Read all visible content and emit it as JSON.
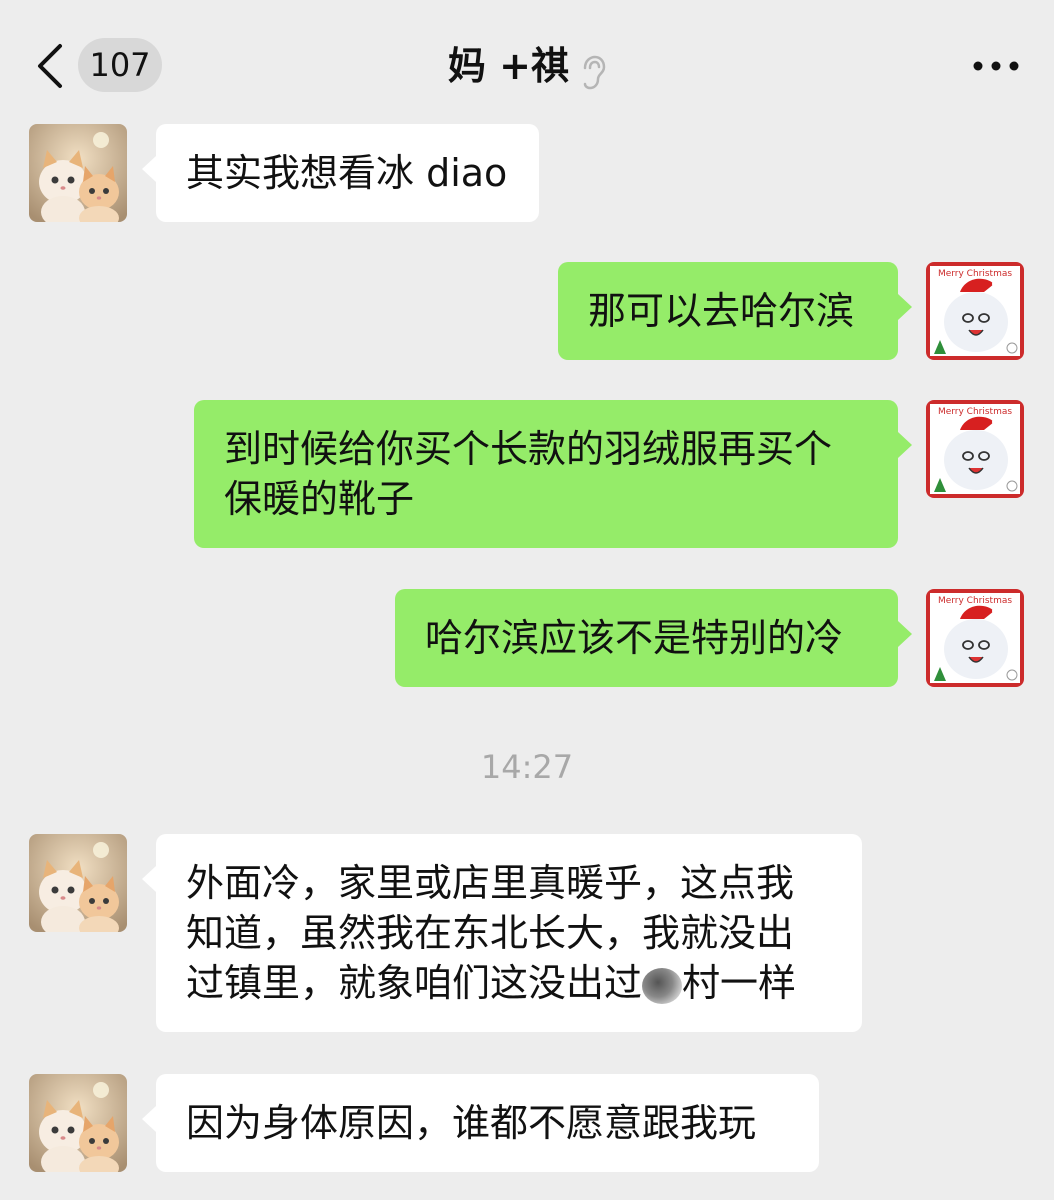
{
  "header": {
    "unread_count": "107",
    "title": "妈 +祺",
    "back_icon": "chevron-left-icon",
    "ear_icon": "ear-icon",
    "more_icon": "more-horizontal-icon"
  },
  "messages": [
    {
      "sender": "incoming",
      "avatar": "cats-avatar",
      "text": "其实我想看冰 diao"
    },
    {
      "sender": "outgoing",
      "avatar": "christmas-cat-avatar",
      "text": "那可以去哈尔滨"
    },
    {
      "sender": "outgoing",
      "avatar": "christmas-cat-avatar",
      "line1": "到时候给你买个长款的羽绒服再买个",
      "line2": "保暖的靴子"
    },
    {
      "sender": "outgoing",
      "avatar": "christmas-cat-avatar",
      "text": "哈尔滨应该不是特别的冷"
    },
    {
      "timestamp": "14:27"
    },
    {
      "sender": "incoming",
      "avatar": "cats-avatar",
      "line1": "外面冷，家里或店里真暖乎，这点我",
      "line2": "知道，虽然我在东北长大，我就没出",
      "line3_a": "过镇里，就象咱们这没出过",
      "line3_b": "村一样"
    },
    {
      "sender": "incoming",
      "avatar": "cats-avatar",
      "text": "因为身体原因，谁都不愿意跟我玩"
    }
  ],
  "avatar_badge_text": "Merry Christmas",
  "colors": {
    "background": "#ededed",
    "outgoing_bubble": "#95ec69",
    "incoming_bubble": "#ffffff",
    "timestamp": "#a8a8a8"
  }
}
